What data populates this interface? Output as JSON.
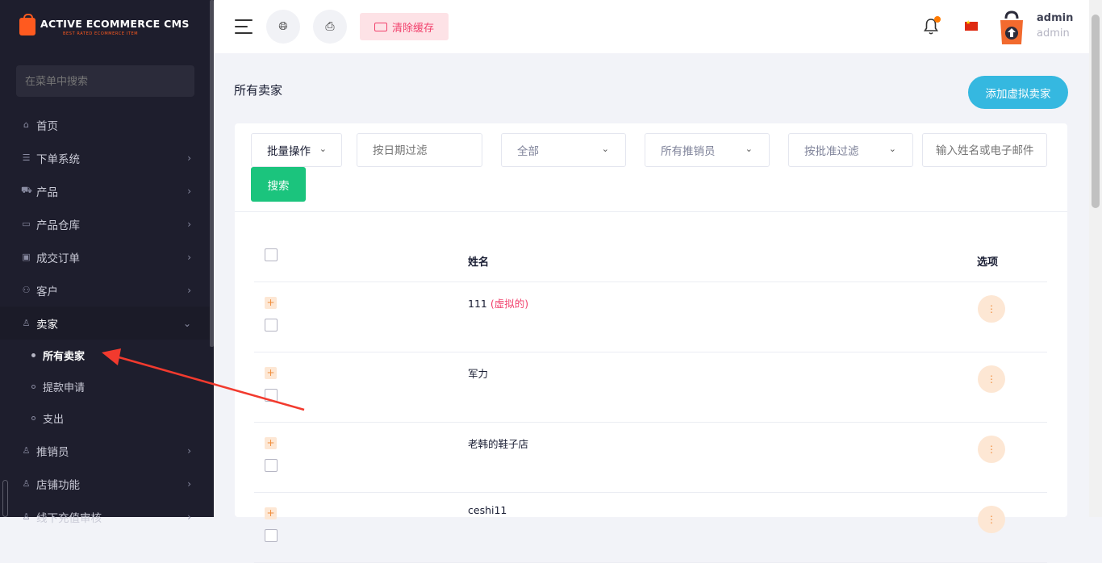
{
  "brand": {
    "title": "ACTIVE ECOMMERCE CMS",
    "subtitle": "BEST RATED ECOMMERCE ITEM"
  },
  "sidebar": {
    "search_placeholder": "在菜单中搜索",
    "items": [
      {
        "label": "首页",
        "icon": "home-icon",
        "glyph": "⌂"
      },
      {
        "label": "下单系统",
        "icon": "list-icon",
        "glyph": "☰"
      },
      {
        "label": "产品",
        "icon": "cart-icon",
        "glyph": "🛒"
      },
      {
        "label": "产品仓库",
        "icon": "warehouse-icon",
        "glyph": "▭"
      },
      {
        "label": "成交订单",
        "icon": "money-icon",
        "glyph": "▣"
      },
      {
        "label": "客户",
        "icon": "users-icon",
        "glyph": "⚇"
      },
      {
        "label": "卖家",
        "icon": "user-icon",
        "glyph": "♙"
      },
      {
        "label": "推销员",
        "icon": "user-icon",
        "glyph": "♙"
      },
      {
        "label": "店铺功能",
        "icon": "user-icon",
        "glyph": "♙"
      },
      {
        "label": "线下充值审核",
        "icon": "user-icon",
        "glyph": "♙"
      }
    ],
    "seller_sub": [
      "所有卖家",
      "提款申请",
      "支出"
    ]
  },
  "header": {
    "clear_cache": "清除缓存",
    "user_name": "admin",
    "user_role": "admin"
  },
  "page": {
    "title": "所有卖家",
    "add_button": "添加虚拟卖家"
  },
  "filters": {
    "bulk": "批量操作",
    "date_placeholder": "按日期过滤",
    "status": "全部",
    "salesman": "所有推销员",
    "approval": "按批准过滤",
    "search_placeholder": "输入姓名或电子邮件",
    "search_button": "搜索"
  },
  "table": {
    "col_name": "姓名",
    "col_options": "选项",
    "rows": [
      {
        "name": "111",
        "tag": "(虚拟的)"
      },
      {
        "name": "军力",
        "tag": ""
      },
      {
        "name": "老韩的鞋子店",
        "tag": ""
      },
      {
        "name": "ceshi11",
        "tag": ""
      }
    ]
  },
  "colors": {
    "sidebar_bg": "#1e1e2d",
    "accent_blue": "#35b8e0",
    "search_green": "#1bc47d",
    "danger": "#f1416c",
    "annotation_arrow": "#f23a2e"
  }
}
